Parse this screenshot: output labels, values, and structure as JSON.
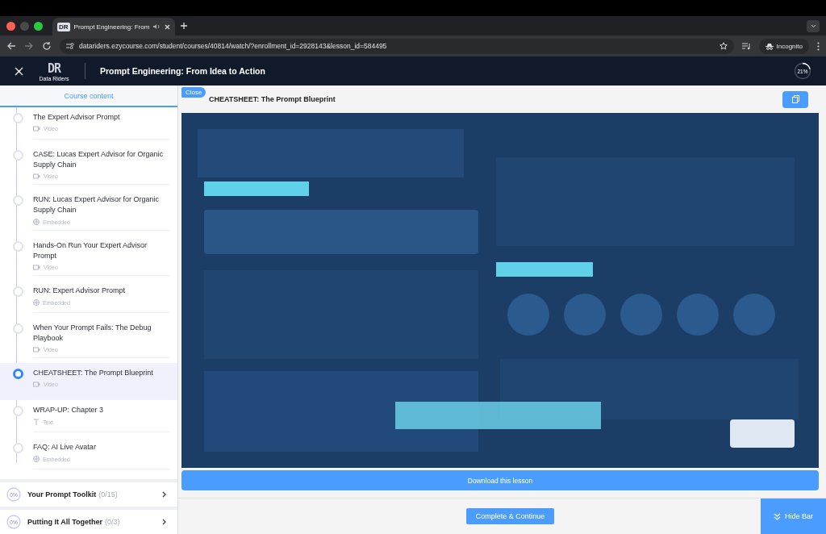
{
  "browser": {
    "tab": {
      "favicon": "DR",
      "title": "Prompt Engineering: From"
    },
    "url": "datariders.ezycourse.com/student/courses/40814/watch/?enrollment_id=2928143&lesson_id=584495",
    "profile": "Incognito"
  },
  "header": {
    "logo": "DR",
    "logo_caption": "Data Riders",
    "title": "Prompt Engineering: From Idea to Action",
    "progress": {
      "label": "21%",
      "level": 0.21
    }
  },
  "sidebar": {
    "heading": "Course content",
    "lessons": [
      {
        "title": "The Expert Advisor Prompt",
        "kind": "video",
        "type_label": "Video",
        "selected": false
      },
      {
        "title": "CASE: Lucas Expert Advisor for Organic Supply Chain",
        "kind": "video",
        "type_label": "Video",
        "selected": false
      },
      {
        "title": "RUN: Lucas Expert Advisor for Organic Supply Chain",
        "kind": "embedded",
        "type_label": "Embedded",
        "selected": false
      },
      {
        "title": "Hands-On Run Your Expert Advisor Prompt",
        "kind": "video",
        "type_label": "Video",
        "selected": false
      },
      {
        "title": "RUN: Expert Advisor Prompt",
        "kind": "embedded",
        "type_label": "Embedded",
        "selected": false
      },
      {
        "title": "When Your Prompt Fails: The Debug Playbook",
        "kind": "video",
        "type_label": "Video",
        "selected": false
      },
      {
        "title": "CHEATSHEET: The Prompt Blueprint",
        "kind": "video",
        "type_label": "Video",
        "selected": true
      },
      {
        "title": "WRAP-UP: Chapter 3",
        "kind": "text",
        "type_label": "Text",
        "selected": false
      },
      {
        "title": "FAQ: AI Live Avatar",
        "kind": "embedded",
        "type_label": "Embedded",
        "selected": false
      }
    ],
    "sections": [
      {
        "progress": "0%",
        "level": 0,
        "title": "Your Prompt Toolkit",
        "count": "(0/15)"
      },
      {
        "progress": "0%",
        "level": 0,
        "title": "Putting It All Together",
        "count": "(0/3)"
      }
    ]
  },
  "lesson": {
    "close": "Close",
    "title": "CHEATSHEET: The Prompt Blueprint",
    "download": "Download this lesson"
  },
  "footer": {
    "complete": "Complete & Continue",
    "hide": "Hide Bar"
  }
}
